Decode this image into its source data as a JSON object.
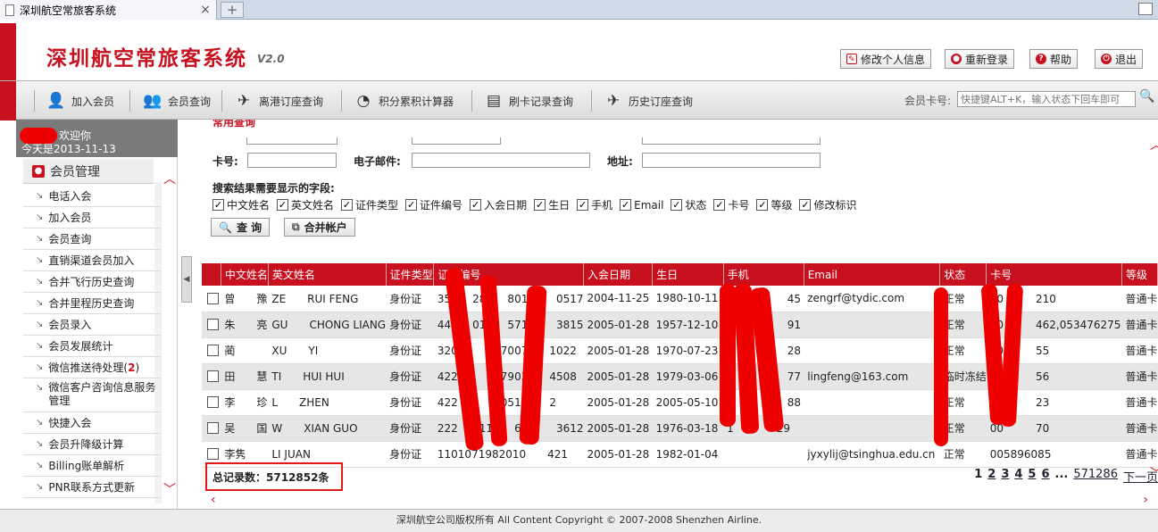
{
  "browser": {
    "tab_title": "深圳航空常旅客系统",
    "close": "×",
    "new_tab": "+"
  },
  "header": {
    "title": "深圳航空常旅客系统",
    "version": "V2.0",
    "buttons": {
      "edit_profile": "修改个人信息",
      "relogin": "重新登录",
      "help": "帮助",
      "logout": "退出"
    }
  },
  "toolbar": {
    "items": [
      "加入会员",
      "会员查询",
      "离港订座查询",
      "积分累积计算器",
      "刷卡记录查询",
      "历史订座查询"
    ],
    "card_label": "会员卡号:",
    "card_placeholder": "快捷键ALT+K，输入状态下回车即可"
  },
  "sidebar": {
    "welcome": "欢迎你",
    "date": "今天是2013-11-13",
    "section": "会员管理",
    "items": [
      "电话入会",
      "加入会员",
      "会员查询",
      "直销渠道会员加入",
      "合并飞行历史查询",
      "合并里程历史查询",
      "会员录入",
      "会员发展统计",
      "微信推送待处理(",
      "微信客户咨询信息服务管理",
      "快捷入会",
      "会员升降级计算",
      "Billing账单解析",
      "PNR联系方式更新"
    ],
    "wechat_badge": "2",
    "wechat_close": ")"
  },
  "query": {
    "section_title": "常用查询",
    "card_label": "卡号:",
    "email_label": "电子邮件:",
    "address_label": "地址:",
    "fields_header": "搜索结果需要显示的字段:",
    "fields": [
      "中文姓名",
      "英文姓名",
      "证件类型",
      "证件编号",
      "入会日期",
      "生日",
      "手机",
      "Email",
      "状态",
      "卡号",
      "等级",
      "修改标识"
    ],
    "check_mark": "✓",
    "query_button": "查 询",
    "merge_button": "合并帐户"
  },
  "table": {
    "headers": [
      "中文姓名",
      "英文姓名",
      "证件类型",
      "证件编号",
      "入会日期",
      "生日",
      "手机",
      "Email",
      "状态",
      "卡号",
      "等级"
    ],
    "rows": [
      [
        "曾　　豫",
        "ZE　　RUI FENG",
        "身份证",
        "35　　28　　8010　　0517",
        "2004-11-25",
        "1980-10-11",
        "1　　　　　45",
        "zengrf@tydic.com",
        "正常",
        "00　　　210",
        "普通卡"
      ],
      [
        "朱　　亮",
        "GU　　CHONG LIANG",
        "身份证",
        "44　　01　　5712　　3815",
        "2005-01-28",
        "1957-12-10",
        "1　　　　　91",
        "",
        "正常",
        "00　　　462,053476275",
        "普通卡"
      ],
      [
        "蔺　　",
        "XU　　YI",
        "身份证",
        "320　　　　7007　　1022",
        "2005-01-28",
        "1970-07-23",
        "1　　　　　28",
        "",
        "正常",
        "00　　　55",
        "普通卡"
      ],
      [
        "田　　慧",
        "TI　　HUI HUI",
        "身份证",
        "422　　　　7903　　4508",
        "2005-01-28",
        "1979-03-06",
        "1　　　　　77",
        "lingfeng@163.com",
        "临时冻结",
        "00　　　56",
        "普通卡"
      ],
      [
        "李　　珍",
        "L　　ZHEN",
        "身份证",
        "422　　　　0510　　2",
        "2005-01-28",
        "2005-05-10",
        "1　　　　　88",
        "",
        "正常",
        "00　　　23",
        "普通卡"
      ],
      [
        "吴　　国",
        "W　　XIAN GUO",
        "身份证",
        "222　　11　　603　　3612",
        "2005-01-28",
        "1976-03-18",
        "1　　　　29",
        "",
        "正常",
        "00　　　70",
        "普通卡"
      ],
      [
        "李隽",
        "LI JUAN",
        "身份证",
        "1101071982010　　421",
        "2005-01-28",
        "1982-01-04",
        "",
        "jyxylij@tsinghua.edu.cn",
        "正常",
        "005896085",
        "普通卡"
      ]
    ]
  },
  "total": "总记录数：5712852条",
  "pager": {
    "pages": [
      "1",
      "2",
      "3",
      "4",
      "5",
      "6"
    ],
    "ellipsis": "...",
    "last": "571286",
    "next": "下一页"
  },
  "footer": "深圳航空公司版权所有 All Content Copyright © 2007-2008 Shenzhen Airline.",
  "colors": {
    "brand_red": "#c8101f",
    "toolbar_bg": "#e5e5e5"
  }
}
